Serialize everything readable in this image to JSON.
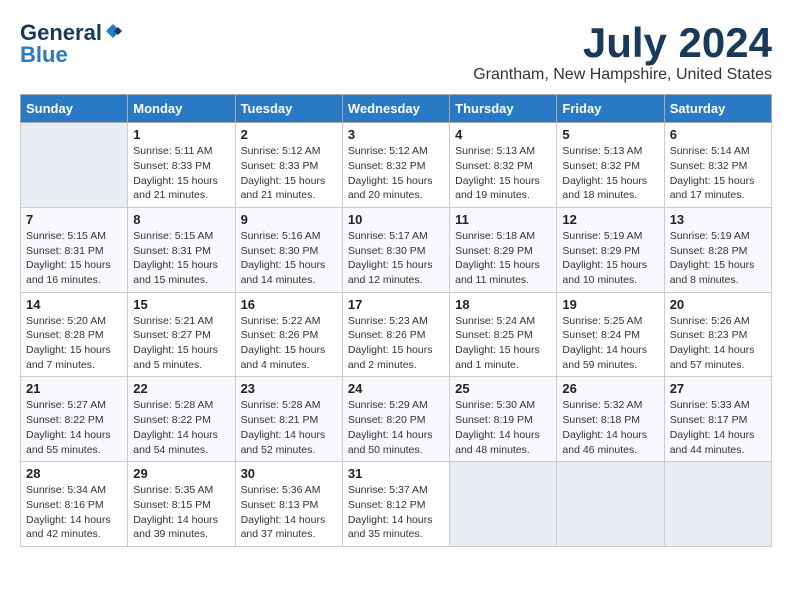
{
  "logo": {
    "line1": "General",
    "line2": "Blue"
  },
  "title": "July 2024",
  "subtitle": "Grantham, New Hampshire, United States",
  "weekdays": [
    "Sunday",
    "Monday",
    "Tuesday",
    "Wednesday",
    "Thursday",
    "Friday",
    "Saturday"
  ],
  "weeks": [
    [
      {
        "day": "",
        "info": ""
      },
      {
        "day": "1",
        "info": "Sunrise: 5:11 AM\nSunset: 8:33 PM\nDaylight: 15 hours\nand 21 minutes."
      },
      {
        "day": "2",
        "info": "Sunrise: 5:12 AM\nSunset: 8:33 PM\nDaylight: 15 hours\nand 21 minutes."
      },
      {
        "day": "3",
        "info": "Sunrise: 5:12 AM\nSunset: 8:32 PM\nDaylight: 15 hours\nand 20 minutes."
      },
      {
        "day": "4",
        "info": "Sunrise: 5:13 AM\nSunset: 8:32 PM\nDaylight: 15 hours\nand 19 minutes."
      },
      {
        "day": "5",
        "info": "Sunrise: 5:13 AM\nSunset: 8:32 PM\nDaylight: 15 hours\nand 18 minutes."
      },
      {
        "day": "6",
        "info": "Sunrise: 5:14 AM\nSunset: 8:32 PM\nDaylight: 15 hours\nand 17 minutes."
      }
    ],
    [
      {
        "day": "7",
        "info": "Sunrise: 5:15 AM\nSunset: 8:31 PM\nDaylight: 15 hours\nand 16 minutes."
      },
      {
        "day": "8",
        "info": "Sunrise: 5:15 AM\nSunset: 8:31 PM\nDaylight: 15 hours\nand 15 minutes."
      },
      {
        "day": "9",
        "info": "Sunrise: 5:16 AM\nSunset: 8:30 PM\nDaylight: 15 hours\nand 14 minutes."
      },
      {
        "day": "10",
        "info": "Sunrise: 5:17 AM\nSunset: 8:30 PM\nDaylight: 15 hours\nand 12 minutes."
      },
      {
        "day": "11",
        "info": "Sunrise: 5:18 AM\nSunset: 8:29 PM\nDaylight: 15 hours\nand 11 minutes."
      },
      {
        "day": "12",
        "info": "Sunrise: 5:19 AM\nSunset: 8:29 PM\nDaylight: 15 hours\nand 10 minutes."
      },
      {
        "day": "13",
        "info": "Sunrise: 5:19 AM\nSunset: 8:28 PM\nDaylight: 15 hours\nand 8 minutes."
      }
    ],
    [
      {
        "day": "14",
        "info": "Sunrise: 5:20 AM\nSunset: 8:28 PM\nDaylight: 15 hours\nand 7 minutes."
      },
      {
        "day": "15",
        "info": "Sunrise: 5:21 AM\nSunset: 8:27 PM\nDaylight: 15 hours\nand 5 minutes."
      },
      {
        "day": "16",
        "info": "Sunrise: 5:22 AM\nSunset: 8:26 PM\nDaylight: 15 hours\nand 4 minutes."
      },
      {
        "day": "17",
        "info": "Sunrise: 5:23 AM\nSunset: 8:26 PM\nDaylight: 15 hours\nand 2 minutes."
      },
      {
        "day": "18",
        "info": "Sunrise: 5:24 AM\nSunset: 8:25 PM\nDaylight: 15 hours\nand 1 minute."
      },
      {
        "day": "19",
        "info": "Sunrise: 5:25 AM\nSunset: 8:24 PM\nDaylight: 14 hours\nand 59 minutes."
      },
      {
        "day": "20",
        "info": "Sunrise: 5:26 AM\nSunset: 8:23 PM\nDaylight: 14 hours\nand 57 minutes."
      }
    ],
    [
      {
        "day": "21",
        "info": "Sunrise: 5:27 AM\nSunset: 8:22 PM\nDaylight: 14 hours\nand 55 minutes."
      },
      {
        "day": "22",
        "info": "Sunrise: 5:28 AM\nSunset: 8:22 PM\nDaylight: 14 hours\nand 54 minutes."
      },
      {
        "day": "23",
        "info": "Sunrise: 5:28 AM\nSunset: 8:21 PM\nDaylight: 14 hours\nand 52 minutes."
      },
      {
        "day": "24",
        "info": "Sunrise: 5:29 AM\nSunset: 8:20 PM\nDaylight: 14 hours\nand 50 minutes."
      },
      {
        "day": "25",
        "info": "Sunrise: 5:30 AM\nSunset: 8:19 PM\nDaylight: 14 hours\nand 48 minutes."
      },
      {
        "day": "26",
        "info": "Sunrise: 5:32 AM\nSunset: 8:18 PM\nDaylight: 14 hours\nand 46 minutes."
      },
      {
        "day": "27",
        "info": "Sunrise: 5:33 AM\nSunset: 8:17 PM\nDaylight: 14 hours\nand 44 minutes."
      }
    ],
    [
      {
        "day": "28",
        "info": "Sunrise: 5:34 AM\nSunset: 8:16 PM\nDaylight: 14 hours\nand 42 minutes."
      },
      {
        "day": "29",
        "info": "Sunrise: 5:35 AM\nSunset: 8:15 PM\nDaylight: 14 hours\nand 39 minutes."
      },
      {
        "day": "30",
        "info": "Sunrise: 5:36 AM\nSunset: 8:13 PM\nDaylight: 14 hours\nand 37 minutes."
      },
      {
        "day": "31",
        "info": "Sunrise: 5:37 AM\nSunset: 8:12 PM\nDaylight: 14 hours\nand 35 minutes."
      },
      {
        "day": "",
        "info": ""
      },
      {
        "day": "",
        "info": ""
      },
      {
        "day": "",
        "info": ""
      }
    ]
  ]
}
